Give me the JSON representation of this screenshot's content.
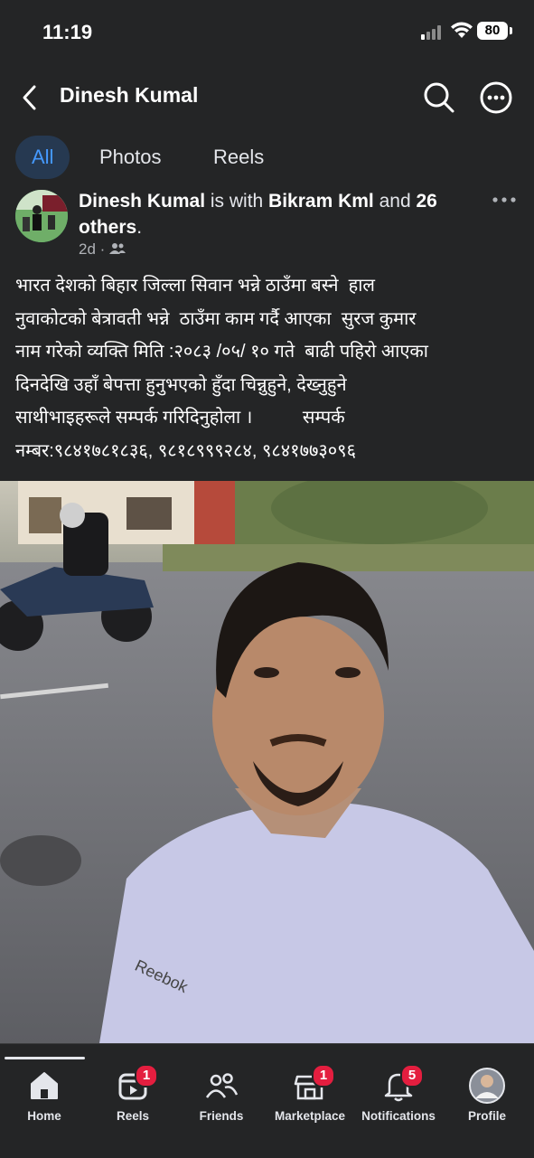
{
  "status_bar": {
    "time": "11:19",
    "battery": "80"
  },
  "header": {
    "title": "Dinesh Kumal"
  },
  "tabs": [
    {
      "label": "All"
    },
    {
      "label": "Photos"
    },
    {
      "label": "Reels"
    }
  ],
  "post": {
    "author": "Dinesh Kumal",
    "with_text": " is with ",
    "tagged": "Bikram Kml",
    "and_text": " and ",
    "others": "26 others",
    "period": ".",
    "time": "2d",
    "separator": "·",
    "text": "भारत देशको बिहार जिल्ला सिवान भन्ने ठाउँमा बस्ने  हाल\nनुवाकोटको बेत्रावती भन्ने  ठाउँमा काम गर्दै आएका  सुरज कुमार\nनाम गरेको व्यक्ति मिति :२०८३ /०५/ १० गते  बाढी पहिरो आएका\nदिनदेखि उहाँ बेपत्ता हुनुभएको हुँदा चिन्नुहुने, देख्नुहुने\nसाथीभाइहरूले सम्पर्क गरिदिनुहोला ।          सम्पर्क\nनम्बर:९८४१७८१८३६, ९८१८९९९२८४, ९८४१७७३०९६",
    "photo_print": "Reebok"
  },
  "bottom_nav": [
    {
      "label": "Home",
      "badge": ""
    },
    {
      "label": "Reels",
      "badge": "1"
    },
    {
      "label": "Friends",
      "badge": ""
    },
    {
      "label": "Marketplace",
      "badge": "1"
    },
    {
      "label": "Notifications",
      "badge": "5"
    },
    {
      "label": "Profile",
      "badge": ""
    }
  ],
  "colors": {
    "background": "#242526",
    "accent": "#4599ff",
    "active_tab_bg": "#263951",
    "badge": "#e41e3f"
  },
  "icons": [
    "back-arrow-icon",
    "search-icon",
    "more-icon",
    "friends-audience-icon",
    "home-icon",
    "reels-icon",
    "friends-icon",
    "marketplace-icon",
    "bell-icon"
  ]
}
